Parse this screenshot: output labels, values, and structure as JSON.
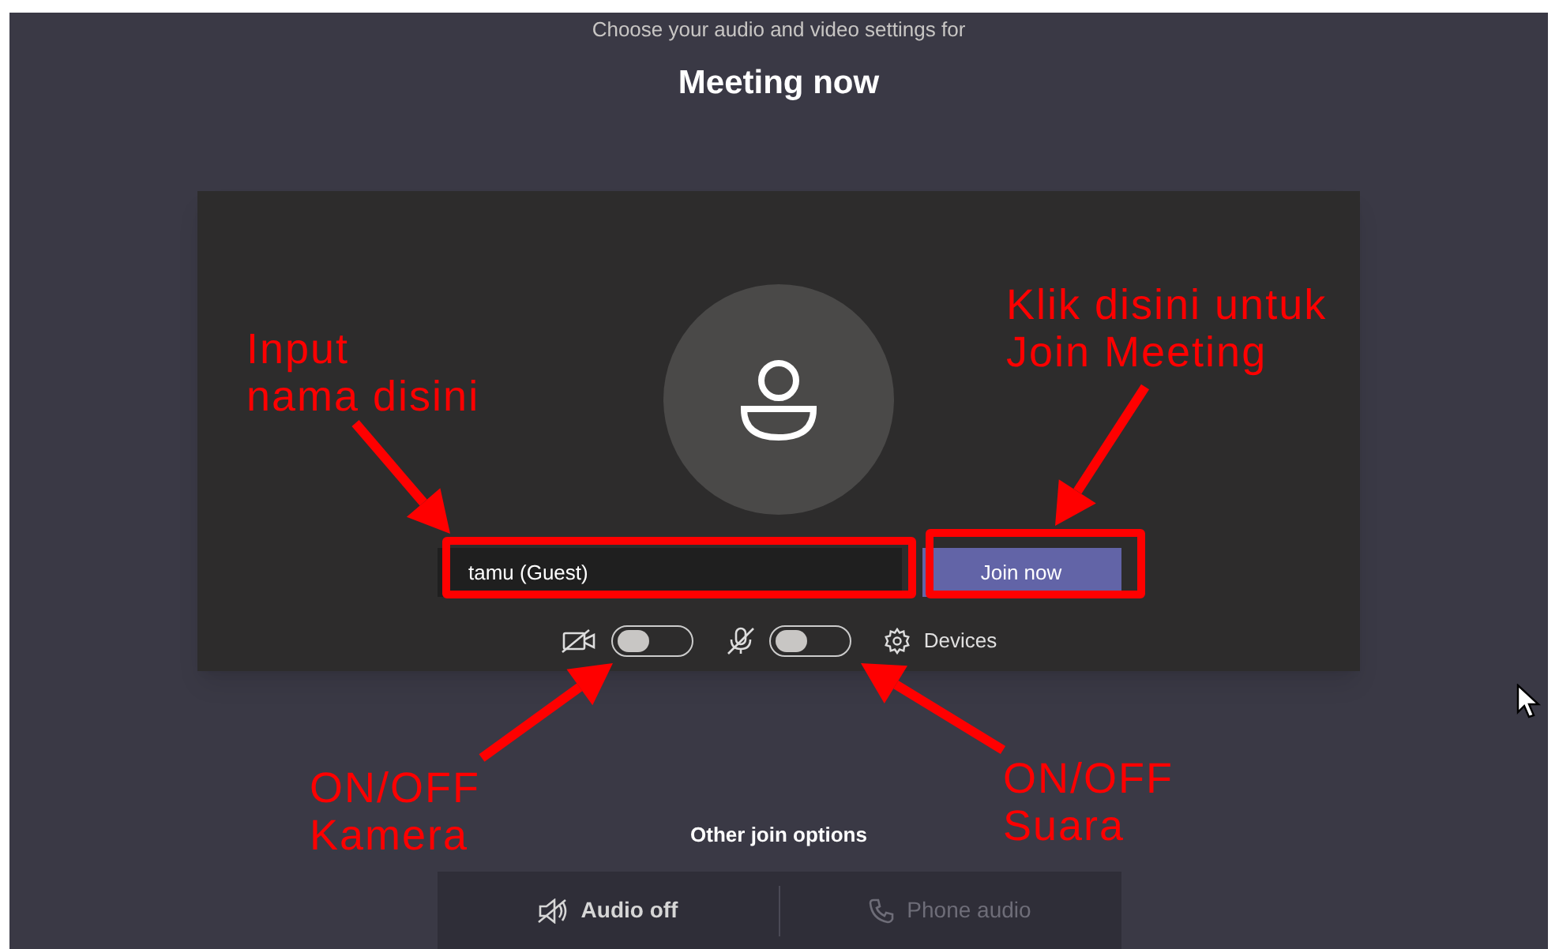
{
  "header": {
    "subtitle": "Choose your audio and video settings for",
    "title": "Meeting now"
  },
  "name_field": {
    "value": "tamu (Guest)"
  },
  "join_button": {
    "label": "Join now"
  },
  "toggles": [
    {
      "kind": "camera",
      "on": false
    },
    {
      "kind": "microphone",
      "on": false
    }
  ],
  "devices": {
    "label": "Devices"
  },
  "other_join_options": {
    "title": "Other join options",
    "options": [
      {
        "kind": "audio-off",
        "label": "Audio off",
        "disabled": false
      },
      {
        "kind": "phone",
        "label": "Phone audio",
        "disabled": true
      }
    ]
  },
  "annotations": [
    {
      "kind": "input",
      "lines": [
        "Input",
        "nama disini"
      ]
    },
    {
      "kind": "join",
      "lines": [
        "Klik disini untuk",
        "Join Meeting"
      ]
    },
    {
      "kind": "camera",
      "lines": [
        "ON/OFF",
        "Kamera"
      ]
    },
    {
      "kind": "sound",
      "lines": [
        "ON/OFF",
        "Suara"
      ]
    }
  ]
}
